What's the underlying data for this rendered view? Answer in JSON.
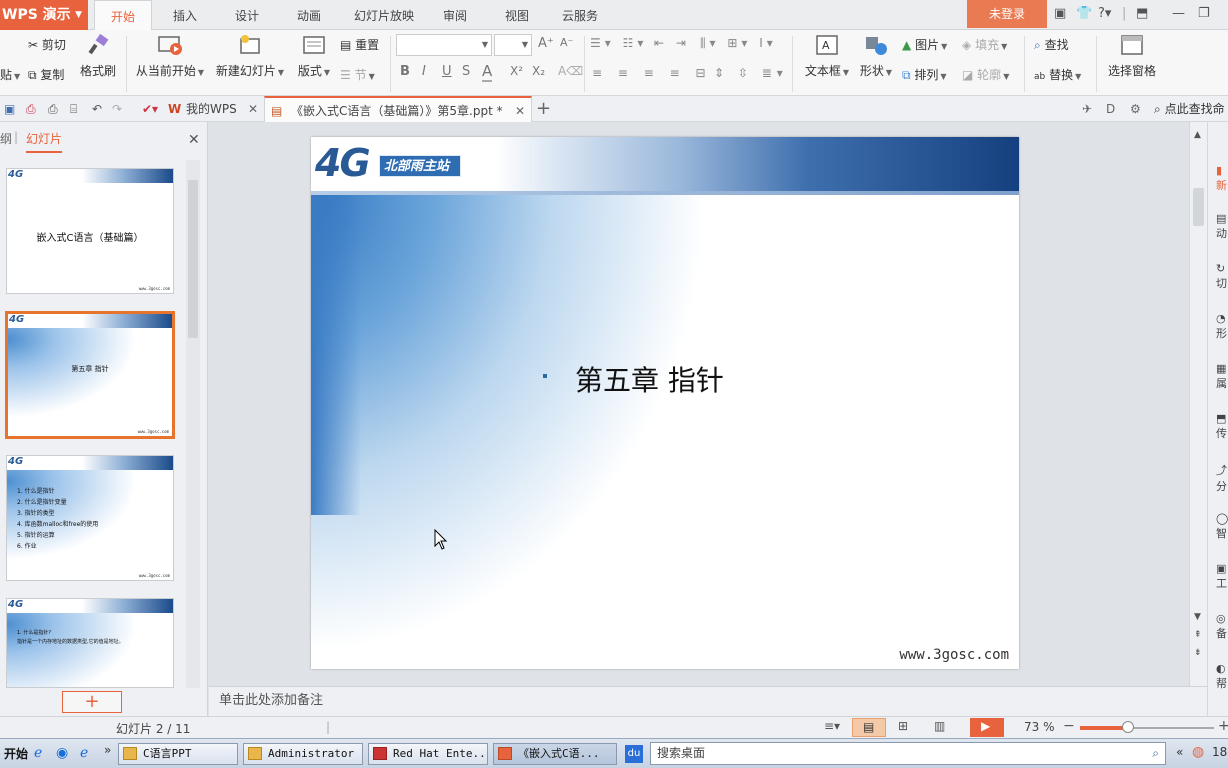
{
  "menubar": {
    "app_name": "WPS 演示",
    "tabs": [
      "开始",
      "插入",
      "设计",
      "动画",
      "幻灯片放映",
      "审阅",
      "视图",
      "云服务"
    ],
    "active_tab": "开始",
    "login": "未登录"
  },
  "ribbon": {
    "paste": "贴",
    "cut": "剪切",
    "copy": "复制",
    "format_painter": "格式刷",
    "from_current": "从当前开始",
    "new_slide": "新建幻灯片",
    "layout": "版式",
    "reset": "重置",
    "section": "节",
    "font_size_up": "A⁺",
    "font_size_down": "A⁻",
    "bold": "B",
    "italic": "I",
    "underline": "U",
    "shadow": "S",
    "font_color": "A",
    "superscript": "X²",
    "subscript": "X₂",
    "textbox": "文本框",
    "shapes": "形状",
    "picture": "图片",
    "fill": "填充",
    "arrange": "排列",
    "outline": "轮廓",
    "find": "查找",
    "replace": "替换",
    "selection_pane": "选择窗格"
  },
  "quickbar": {
    "tabs": [
      {
        "label": "我的WPS"
      },
      {
        "label": "《嵌入式C语言（基础篇）》第5章.ppt *"
      }
    ],
    "search": "点此查找命"
  },
  "leftpanel": {
    "outline_tab": "纲",
    "slides_tab": "幻灯片",
    "thumbs": [
      {
        "title": "嵌入式C语言（基础篇）",
        "url": "www.3gosc.com"
      },
      {
        "title": "第五章 指针",
        "url": "www.3gosc.com"
      },
      {
        "lines": [
          "1. 什么是指针",
          "2. 什么是指针变量",
          "3. 指针的类型",
          "4. 库函数malloc和free的使用",
          "5. 指针的运算",
          "6. 作业"
        ],
        "url": "www.3gosc.com"
      },
      {
        "lines": [
          "1. 什么是指针?",
          "   指针是一个内存地址的数据类型,它的值是地址。"
        ]
      }
    ],
    "add_button": "+"
  },
  "slide": {
    "logo_text": "4G",
    "logo_badge": "北部雨主站",
    "title": "第五章 指针",
    "url": "www.3gosc.com"
  },
  "rightbar": {
    "items": [
      "新",
      "动",
      "切",
      "形",
      "属",
      "传",
      "分",
      "智",
      "工",
      "备",
      "帮"
    ]
  },
  "notes": {
    "placeholder": "单击此处添加备注"
  },
  "status": {
    "slide_counter": "幻灯片 2 / 11",
    "zoom": "73 %"
  },
  "taskbar": {
    "start": "开始",
    "items": [
      "C语言PPT",
      "Administrator",
      "Red Hat Ente...",
      "《嵌入式C语...",
      "du"
    ],
    "search_placeholder": "搜索桌面",
    "clock": "18"
  },
  "colors": {
    "accent": "#e8633d",
    "slide_blue": "#15407f"
  }
}
